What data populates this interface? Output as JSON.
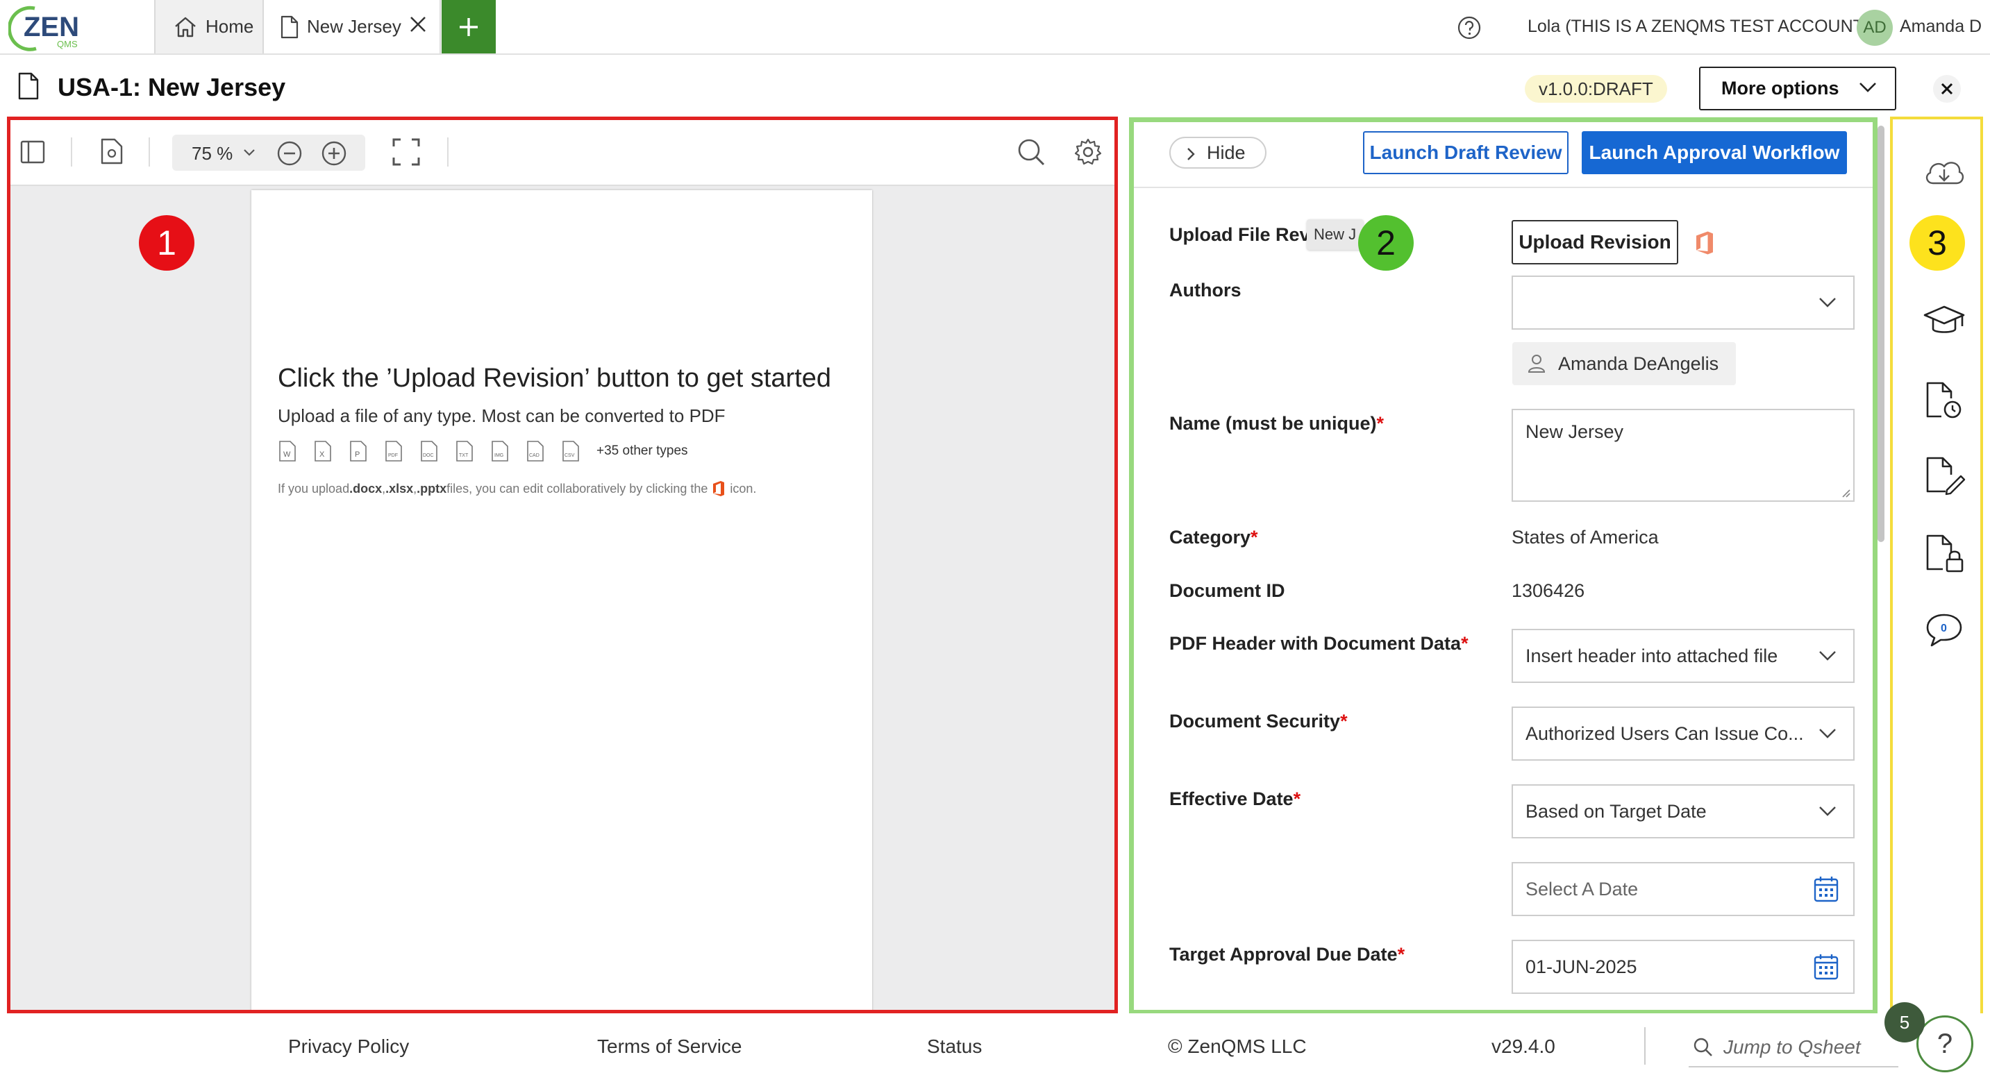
{
  "app": {
    "logo_text": "ZEN",
    "logo_sub": "QMS"
  },
  "tabs": [
    {
      "label": "Home",
      "icon": "home-icon"
    },
    {
      "label": "New Jersey",
      "icon": "document-icon"
    }
  ],
  "topbar": {
    "account": "Lola (THIS IS A ZENQMS TEST ACCOUNT)",
    "user_initials": "AD",
    "user_name": "Amanda D"
  },
  "header": {
    "title": "USA-1: New Jersey",
    "version": "v1.0.0:DRAFT",
    "more_options": "More options"
  },
  "viewer": {
    "zoom": "75 %",
    "heading": "Click the ’Upload Revision’ button to get started",
    "subheading": "Upload a file of any type. Most can be converted to PDF",
    "file_types": [
      "W",
      "X",
      "P",
      "PDF",
      "DOC",
      "TXT",
      "IMG",
      "CAD",
      "CSV"
    ],
    "other_types": "+35 other types",
    "note_prefix": "If you upload ",
    "note_ext1": ".docx",
    "note_sep1": ", ",
    "note_ext2": ".xlsx",
    "note_sep2": ", ",
    "note_ext3": ".pptx",
    "note_middle": " files, you can edit collaboratively by clicking the",
    "note_suffix": "icon."
  },
  "form": {
    "hide_label": "Hide",
    "draft_review_label": "Launch Draft Review",
    "approval_label": "Launch Approval Workflow",
    "upload_file_label": "Upload File Revi",
    "tooltip_text": "New J",
    "upload_revision_label": "Upload Revision",
    "authors_label": "Authors",
    "author_chip": "Amanda DeAngelis",
    "name_label": "Name (must be unique)",
    "name_value": "New Jersey",
    "category_label": "Category",
    "category_value": "States of America",
    "doc_id_label": "Document ID",
    "doc_id_value": "1306426",
    "pdf_header_label": "PDF Header with Document Data",
    "pdf_header_value": "Insert header into attached file",
    "security_label": "Document Security",
    "security_value": "Authorized Users Can Issue Co...",
    "effective_label": "Effective Date",
    "effective_value": "Based on Target Date",
    "select_date_placeholder": "Select A Date",
    "target_label": "Target Approval Due Date",
    "target_value": "01-JUN-2025",
    "required_mark": "*"
  },
  "annotations": {
    "one": "1",
    "two": "2",
    "three": "3"
  },
  "rail": {
    "icons": [
      "cloud-download-icon",
      "graduation-cap-icon",
      "document-history-icon",
      "document-edit-icon",
      "document-lock-icon",
      "comments-icon"
    ],
    "comment_count": "0"
  },
  "footer": {
    "privacy": "Privacy Policy",
    "terms": "Terms of Service",
    "status": "Status",
    "copyright": "© ZenQMS LLC",
    "version": "v29.4.0",
    "search_placeholder": "Jump to Qsheet",
    "help_count": "5",
    "help_symbol": "?"
  },
  "colors": {
    "brand_green": "#3b8a2b",
    "primary_blue": "#1668d3",
    "annotation_red": "#e12222",
    "annotation_green": "#98d97e",
    "annotation_yellow": "#f4dc3c",
    "required_red": "#dd1111"
  }
}
